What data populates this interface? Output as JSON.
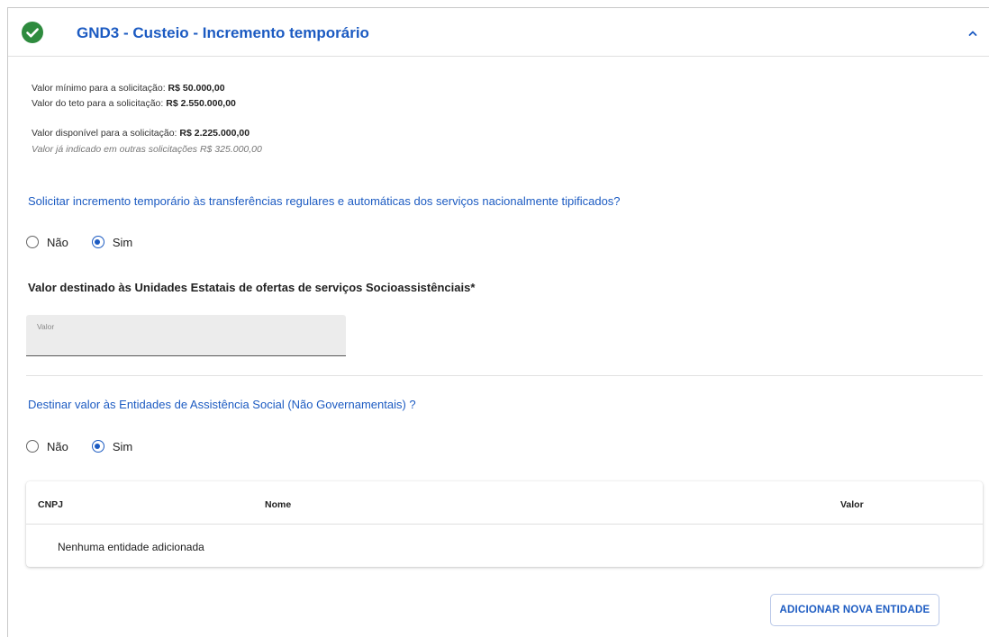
{
  "header": {
    "title": "GND3 - Custeio - Incremento temporário",
    "status_icon": "check-circle-icon",
    "status_color": "#2e8b3e",
    "toggle_icon": "chevron-up-icon"
  },
  "info": {
    "min_label": "Valor mínimo para a solicitação: ",
    "min_value": "R$ 50.000,00",
    "ceiling_label": "Valor do teto para a solicitação: ",
    "ceiling_value": "R$ 2.550.000,00",
    "available_label": "Valor disponível para a solicitação: ",
    "available_value": "R$ 2.225.000,00",
    "already_indicated": "Valor já indicado em outras solicitações R$ 325.000,00"
  },
  "question1": {
    "text": "Solicitar incremento temporário às transferências regulares e automáticas dos serviços nacionalmente tipificados?",
    "options": [
      {
        "label": "Não",
        "checked": false
      },
      {
        "label": "Sim",
        "checked": true
      }
    ]
  },
  "state_units": {
    "title": "Valor destinado às Unidades Estatais de ofertas de serviços Socioassistênciais*",
    "field_label": "Valor",
    "field_value": ""
  },
  "question2": {
    "text": "Destinar valor às Entidades de Assistência Social (Não Governamentais) ?",
    "options": [
      {
        "label": "Não",
        "checked": false
      },
      {
        "label": "Sim",
        "checked": true
      }
    ]
  },
  "entities_table": {
    "columns": [
      "CNPJ",
      "Nome",
      "Valor"
    ],
    "empty_message": "Nenhuma entidade adicionada"
  },
  "actions": {
    "add_entity": "ADICIONAR NOVA ENTIDADE"
  },
  "colors": {
    "accent": "#1c5bc2",
    "success": "#2e8b3e"
  }
}
